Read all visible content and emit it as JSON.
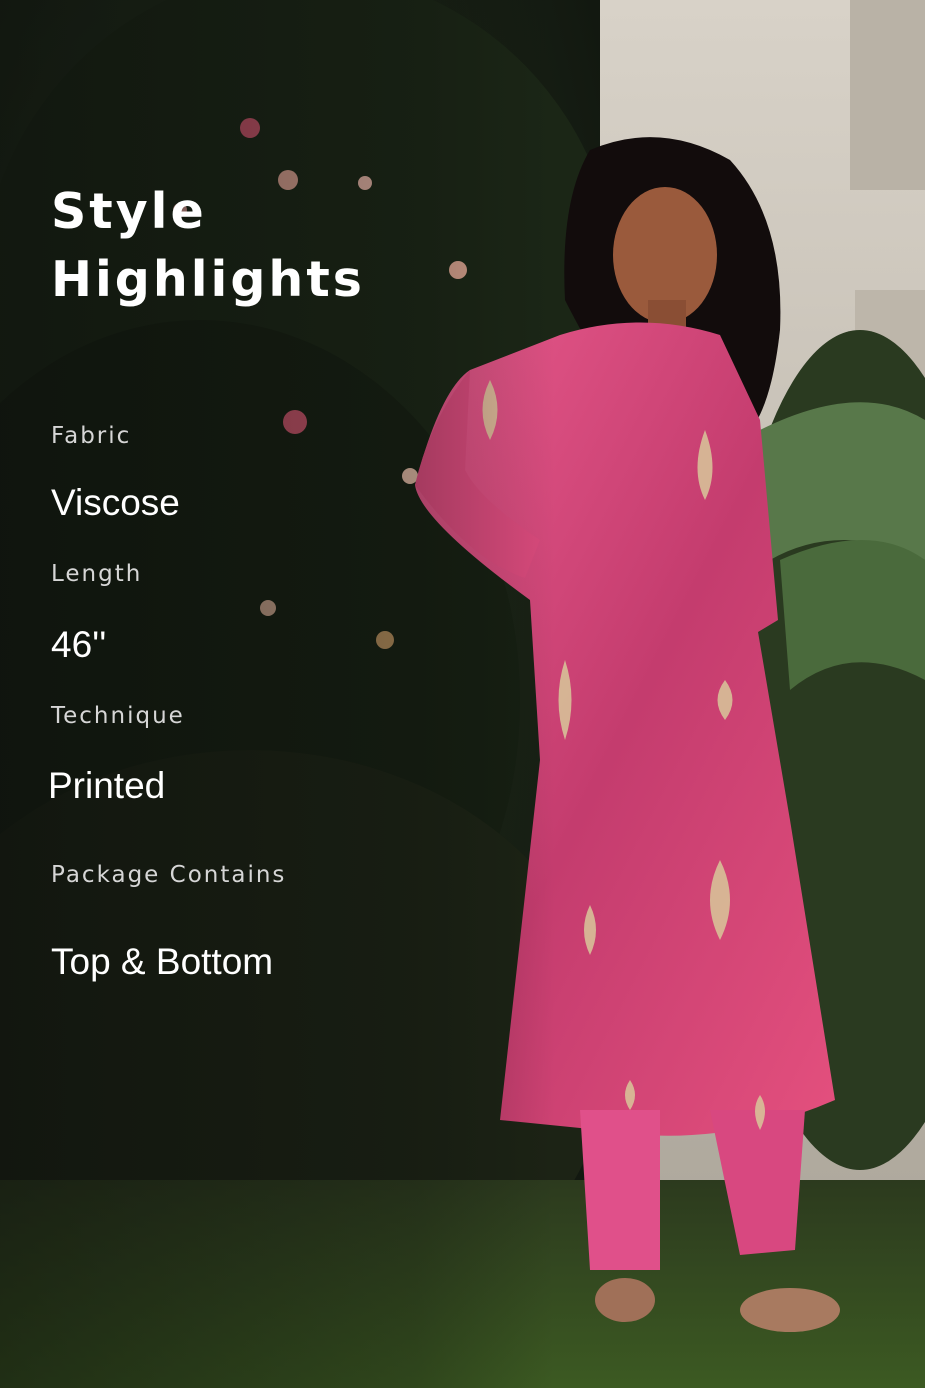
{
  "title_line1": "Style",
  "title_line2": "Highlights",
  "specs": {
    "fabric_label": "Fabric",
    "fabric_value": "Viscose",
    "length_label": "Length",
    "length_value": "46''",
    "technique_label": "Technique",
    "technique_value": "Printed",
    "package_label": "Package Contains",
    "package_value": "Top & Bottom"
  },
  "colors": {
    "kurta": "#e04d80",
    "foliage": "#1e2a1a",
    "wall": "#cfc8bd"
  }
}
